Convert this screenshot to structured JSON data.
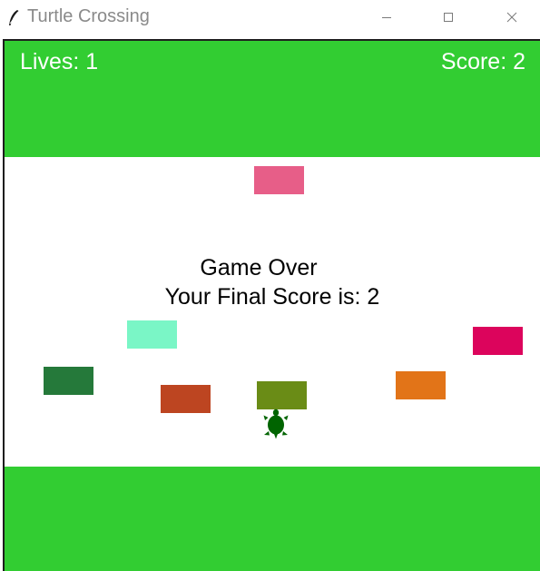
{
  "window": {
    "title": "Turtle Crossing",
    "icon": "feather-icon",
    "controls": [
      "minimize-icon",
      "maximize-icon",
      "close-icon"
    ]
  },
  "hud": {
    "lives": "Lives: 1",
    "score": "Score: 2"
  },
  "game_over": {
    "line1": "Game Over",
    "line2": "Your Final Score is: 2"
  },
  "colors": {
    "grass": "#32cd32",
    "road": "#ffffff",
    "text_hud": "#ffffff",
    "text_message": "#000000",
    "turtle": "#006400"
  },
  "cars": [
    {
      "name": "car-pink",
      "color": "#e75e88"
    },
    {
      "name": "car-aquamarine",
      "color": "#7af6c6"
    },
    {
      "name": "car-crimson",
      "color": "#dc045c"
    },
    {
      "name": "car-dark-green",
      "color": "#25793a"
    },
    {
      "name": "car-orange",
      "color": "#e27418"
    },
    {
      "name": "car-rust",
      "color": "#bd4521"
    },
    {
      "name": "car-olive",
      "color": "#6a8c16"
    }
  ]
}
